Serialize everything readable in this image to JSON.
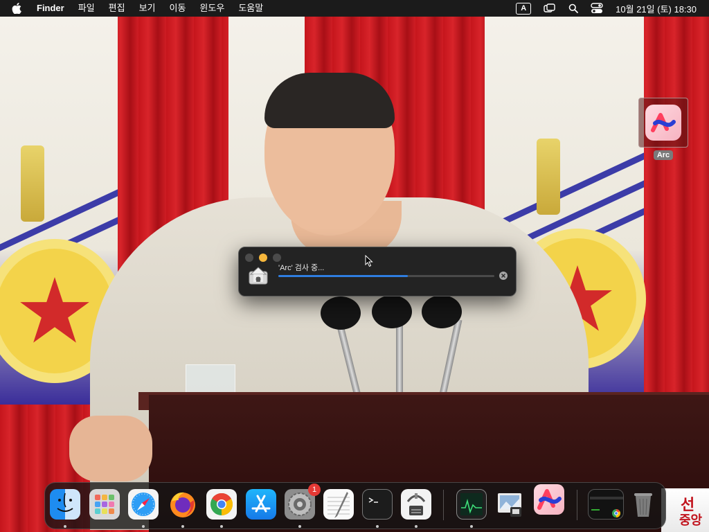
{
  "menubar": {
    "app_name": "Finder",
    "menus": [
      "파일",
      "편집",
      "보기",
      "이동",
      "윈도우",
      "도움말"
    ],
    "input_source": "A",
    "clock": "10월 21일 (토) 18:30"
  },
  "desktop": {
    "icons": [
      {
        "label": "Arc",
        "icon": "arc-app-icon"
      }
    ]
  },
  "dialog": {
    "status_text": "'Arc' 검사 중...",
    "progress_fraction": 0.6,
    "accent": "#2f7de0"
  },
  "dock": {
    "apps": [
      {
        "name": "finder",
        "icon": "finder-icon",
        "running": true
      },
      {
        "name": "launchpad",
        "icon": "launchpad-icon",
        "running": false
      },
      {
        "name": "safari",
        "icon": "safari-icon",
        "running": true
      },
      {
        "name": "firefox",
        "icon": "firefox-icon",
        "running": true
      },
      {
        "name": "chrome",
        "icon": "chrome-icon",
        "running": true
      },
      {
        "name": "app-store",
        "icon": "app-store-icon",
        "running": false
      },
      {
        "name": "system-settings",
        "icon": "settings-icon",
        "running": true,
        "badge": "1"
      },
      {
        "name": "textedit",
        "icon": "textedit-icon",
        "running": false
      },
      {
        "name": "terminal",
        "icon": "terminal-icon",
        "running": true
      },
      {
        "name": "archive-utility",
        "icon": "archive-icon",
        "running": true
      },
      {
        "name": "activity-monitor",
        "icon": "activity-monitor-icon",
        "running": true
      },
      {
        "name": "preview",
        "icon": "preview-icon",
        "running": false
      },
      {
        "name": "arc",
        "icon": "arc-icon",
        "running": false
      },
      {
        "name": "chrome-window",
        "icon": "chrome-window-icon",
        "running": false
      },
      {
        "name": "trash",
        "icon": "trash-icon",
        "running": false
      }
    ]
  },
  "wallpaper_corner_text": [
    "선",
    "중앙"
  ]
}
